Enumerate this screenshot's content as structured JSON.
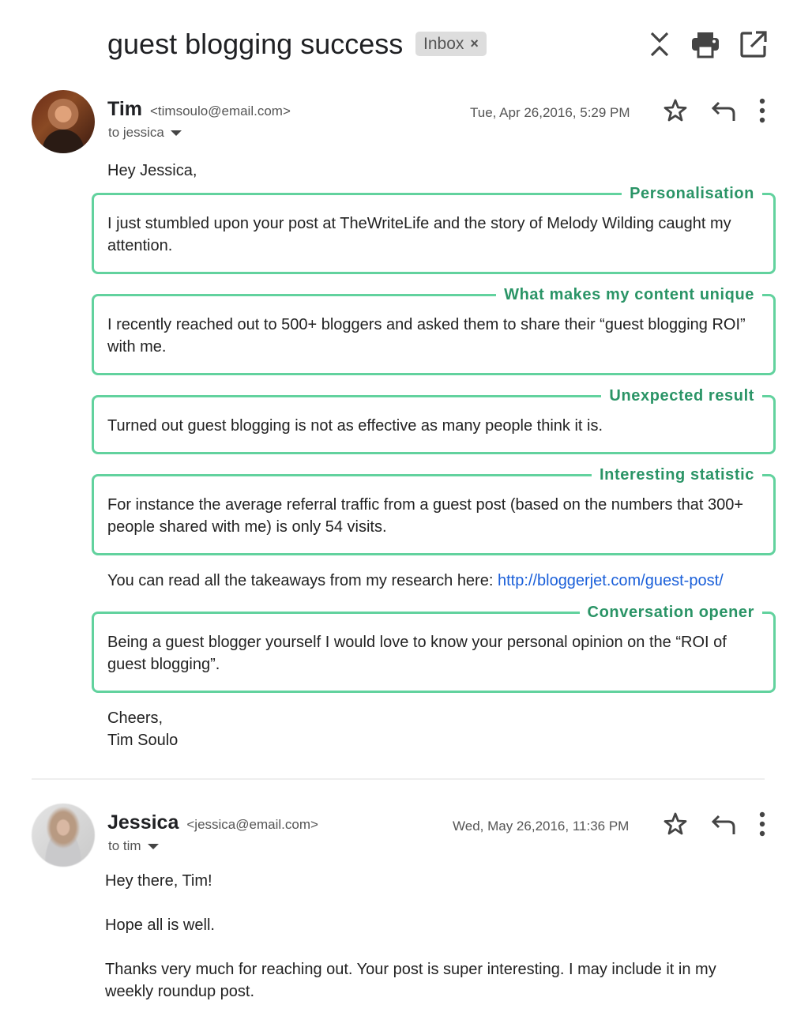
{
  "header": {
    "subject": "guest blogging success",
    "label_badge": "Inbox",
    "label_remove_icon": "×",
    "actions": [
      {
        "name": "collapse-icon",
        "label": "Collapse all"
      },
      {
        "name": "print-icon",
        "label": "Print all"
      },
      {
        "name": "open-new-window-icon",
        "label": "In new window"
      }
    ]
  },
  "messages": [
    {
      "sender_name": "Tim",
      "sender_email": "<timsoulo@email.com>",
      "recipient": "to jessica",
      "date": "Tue, Apr 26,2016, 5:29 PM",
      "greeting": "Hey Jessica,",
      "annotated_blocks": [
        {
          "label": "Personalisation",
          "text": "I just stumbled upon your post at TheWriteLife and the story of Melody Wilding caught my attention."
        },
        {
          "label": "What makes my content unique",
          "text": "I recently reached out to 500+ bloggers and asked them to share their “guest blogging ROI” with me."
        },
        {
          "label": "Unexpected result",
          "text": "Turned out guest blogging is not as effective as many people think it is."
        },
        {
          "label": "Interesting statistic",
          "text": "For instance the average referral traffic from a guest post (based on the numbers that 300+ people shared with me) is only 54 visits."
        }
      ],
      "takeaway_text": "You can read all the takeaways from my research here: ",
      "takeaway_link": "http://bloggerjet.com/guest-post/",
      "closing_block": {
        "label": "Conversation opener",
        "text": "Being a guest blogger yourself I would love to know your personal opinion on the “ROI of guest blogging”."
      },
      "signoff": "Cheers,",
      "signature": "Tim Soulo"
    },
    {
      "sender_name": "Jessica",
      "sender_email": "<jessica@email.com>",
      "recipient": "to tim",
      "date": "Wed, May 26,2016, 11:36 PM",
      "paragraphs": [
        "Hey there, Tim!",
        "Hope all is well.",
        "Thanks very much for reaching out. Your post is super interesting. I may include it in my weekly roundup post."
      ]
    }
  ],
  "colors": {
    "annotation_border": "#62d29e",
    "annotation_label": "#2a9466",
    "link": "#1a5fd9",
    "icon": "#444444"
  }
}
